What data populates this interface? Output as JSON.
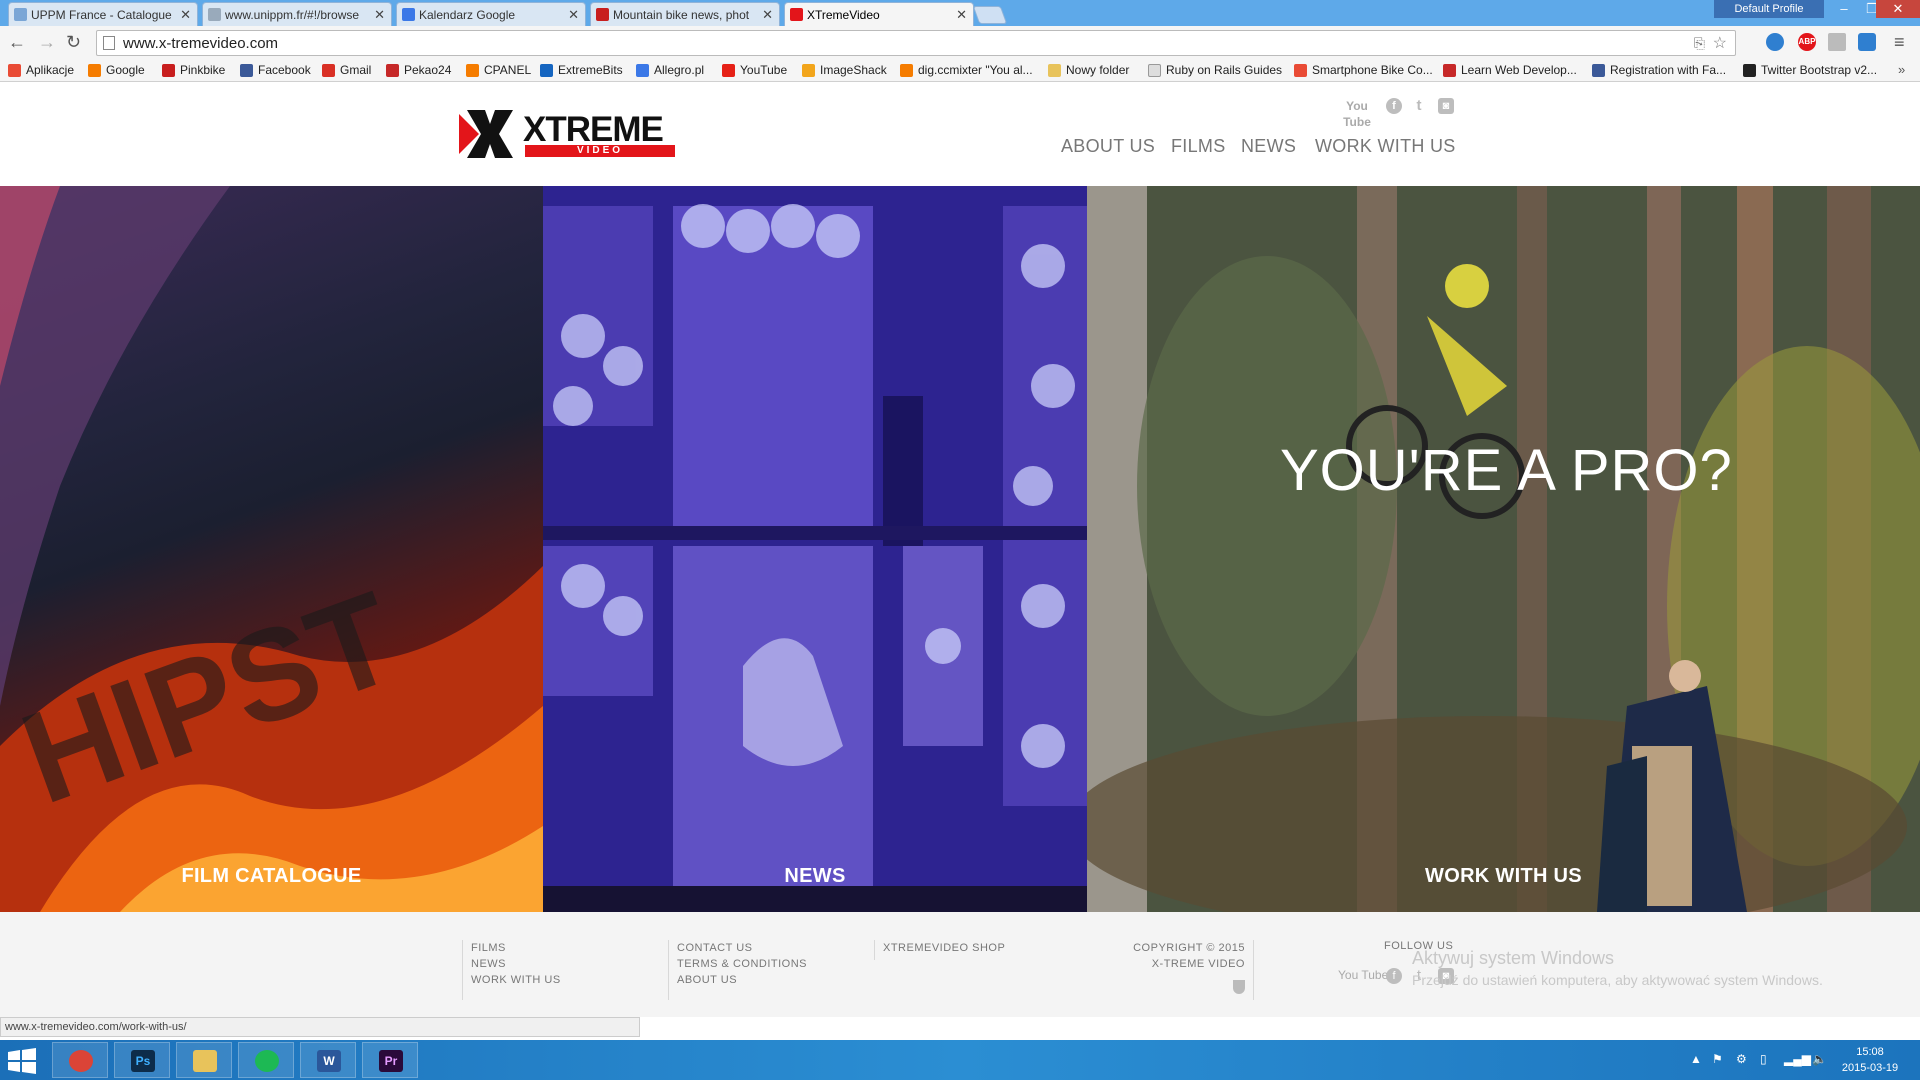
{
  "browser": {
    "tabs": [
      {
        "title": "UPPM France - Catalogue",
        "color": "#7aa6d6"
      },
      {
        "title": "www.unippm.fr/#!/browse",
        "color": "#9ab"
      },
      {
        "title": "Kalendarz Google",
        "color": "#3b78e7"
      },
      {
        "title": "Mountain bike news, phot",
        "color": "#c81e1e"
      },
      {
        "title": "XTremeVideo",
        "color": "#e3151a"
      }
    ],
    "profile": "Default Profile",
    "url": "www.x-tremevideo.com",
    "bookmarks": [
      {
        "label": "Aplikacje",
        "color": "#e94b35"
      },
      {
        "label": "Google",
        "color": "#f57c00"
      },
      {
        "label": "Pinkbike",
        "color": "#c81e1e"
      },
      {
        "label": "Facebook",
        "color": "#3b5998"
      },
      {
        "label": "Gmail",
        "color": "#d93025"
      },
      {
        "label": "Pekao24",
        "color": "#c62828"
      },
      {
        "label": "CPANEL",
        "color": "#f57c00"
      },
      {
        "label": "ExtremeBits",
        "color": "#1565c0"
      },
      {
        "label": "Allegro.pl",
        "color": "#3b78e7"
      },
      {
        "label": "YouTube",
        "color": "#e62117"
      },
      {
        "label": "ImageShack",
        "color": "#f2a51b"
      },
      {
        "label": "dig.ccmixter \"You al...",
        "color": "#f57c00"
      },
      {
        "label": "Nowy folder",
        "color": "#e8c35b"
      },
      {
        "label": "Ruby on Rails Guides",
        "color": "#999"
      },
      {
        "label": "Smartphone Bike Co...",
        "color": "#e94b35"
      },
      {
        "label": "Learn Web Develop...",
        "color": "#c62828"
      },
      {
        "label": "Registration with Fa...",
        "color": "#3b5998"
      },
      {
        "label": "Twitter Bootstrap v2...",
        "color": "#222"
      }
    ]
  },
  "site": {
    "logo": {
      "text": "XTREME",
      "sub": "VIDEO"
    },
    "social": {
      "youtube": "You Tube",
      "facebook": "f",
      "twitter": "t",
      "instagram": "◙"
    },
    "nav": [
      "ABOUT US",
      "FILMS",
      "NEWS",
      "WORK WITH US"
    ],
    "panels": [
      {
        "label": "FILM CATALOGUE"
      },
      {
        "label": "NEWS"
      },
      {
        "label": "WORK WITH US"
      }
    ],
    "hero_text": "YOU'RE A PRO?",
    "footer": {
      "col1": [
        "FILMS",
        "NEWS",
        "WORK WITH US"
      ],
      "col2": [
        "CONTACT US",
        "TERMS & CONDITIONS",
        "ABOUT US"
      ],
      "col3": [
        "XTREMEVIDEO SHOP"
      ],
      "copyright": [
        "COPYRIGHT © 2015",
        "X-TREME VIDEO"
      ],
      "follow": "FOLLOW US"
    },
    "watermark": {
      "line1": "Aktywuj system Windows",
      "line2": "Przejdź do ustawień komputera, aby aktywować system Windows."
    }
  },
  "status_url": "www.x-tremevideo.com/work-with-us/",
  "taskbar": {
    "apps": [
      {
        "name": "chrome",
        "label": "",
        "color": "#db4437"
      },
      {
        "name": "photoshop",
        "label": "Ps",
        "color": "#0d2c4a"
      },
      {
        "name": "explorer",
        "label": "",
        "color": "#e8c35b"
      },
      {
        "name": "spotify",
        "label": "",
        "color": "#1db954"
      },
      {
        "name": "word",
        "label": "W",
        "color": "#2b579a"
      },
      {
        "name": "premiere",
        "label": "Pr",
        "color": "#2a0a3a"
      }
    ],
    "time": "15:08",
    "date": "2015-03-19"
  }
}
